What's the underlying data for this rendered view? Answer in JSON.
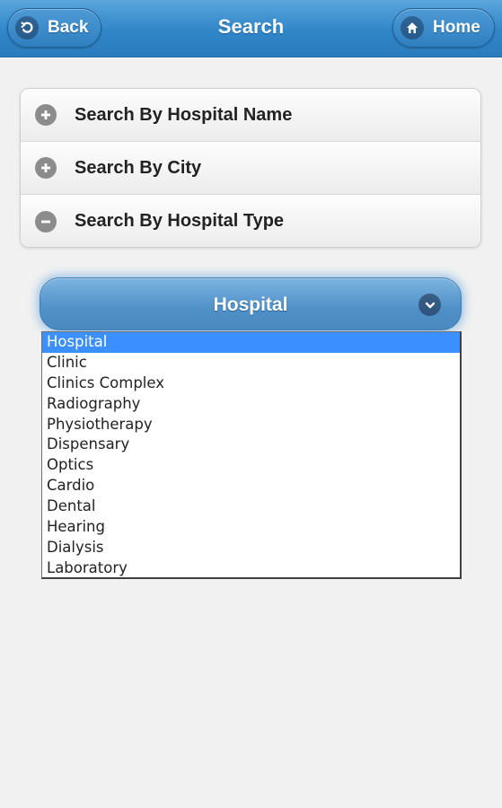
{
  "header": {
    "title": "Search",
    "back_label": "Back",
    "home_label": "Home"
  },
  "accordion": {
    "items": [
      {
        "label": "Search By Hospital Name",
        "state": "collapsed",
        "icon": "plus-icon"
      },
      {
        "label": "Search By City",
        "state": "collapsed",
        "icon": "plus-icon"
      },
      {
        "label": "Search By Hospital Type",
        "state": "expanded",
        "icon": "minus-icon"
      }
    ]
  },
  "hospital_type_select": {
    "selected_value": "Hospital",
    "options": [
      "Hospital",
      "Clinic",
      "Clinics Complex",
      "Radiography",
      "Physiotherapy",
      "Dispensary",
      "Optics",
      "Cardio",
      "Dental",
      "Hearing",
      "Dialysis",
      "Laboratory"
    ]
  },
  "colors": {
    "header_blue": "#2f86c8",
    "select_blue": "#4f90c8",
    "option_highlight": "#3b8fff",
    "background": "#f1f1f1"
  }
}
